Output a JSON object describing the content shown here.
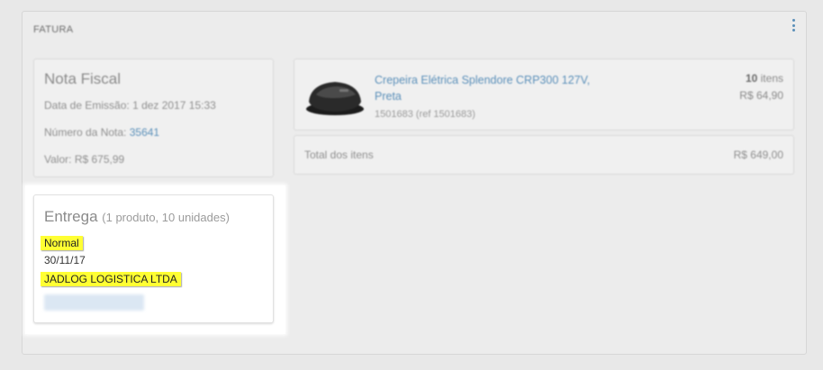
{
  "panel": {
    "title": "FATURA"
  },
  "nota_fiscal": {
    "title": "Nota Fiscal",
    "data_emissao_label": "Data de Emissão:",
    "data_emissao_value": "1 dez 2017 15:33",
    "numero_label": "Número da Nota:",
    "numero_value": "35641",
    "valor_label": "Valor:",
    "valor_value": "R$ 675,99"
  },
  "product": {
    "name": "Crepeira Elétrica Splendore CRP300 127V, Preta",
    "ref": "1501683 (ref 1501683)",
    "qty_number": "10",
    "qty_unit": "itens",
    "price": "R$ 64,90"
  },
  "totals": {
    "label": "Total dos itens",
    "value": "R$ 649,00"
  },
  "entrega": {
    "title": "Entrega",
    "subtitle": "(1 produto, 10 unidades)",
    "shipping_type": "Normal",
    "date": "30/11/17",
    "carrier": "JADLOG LOGISTICA LTDA"
  },
  "colors": {
    "link": "#5a8fb9",
    "highlight": "#ffff33"
  },
  "icons": {
    "menu": "kebab-menu-icon",
    "product": "crepe-maker-image"
  }
}
